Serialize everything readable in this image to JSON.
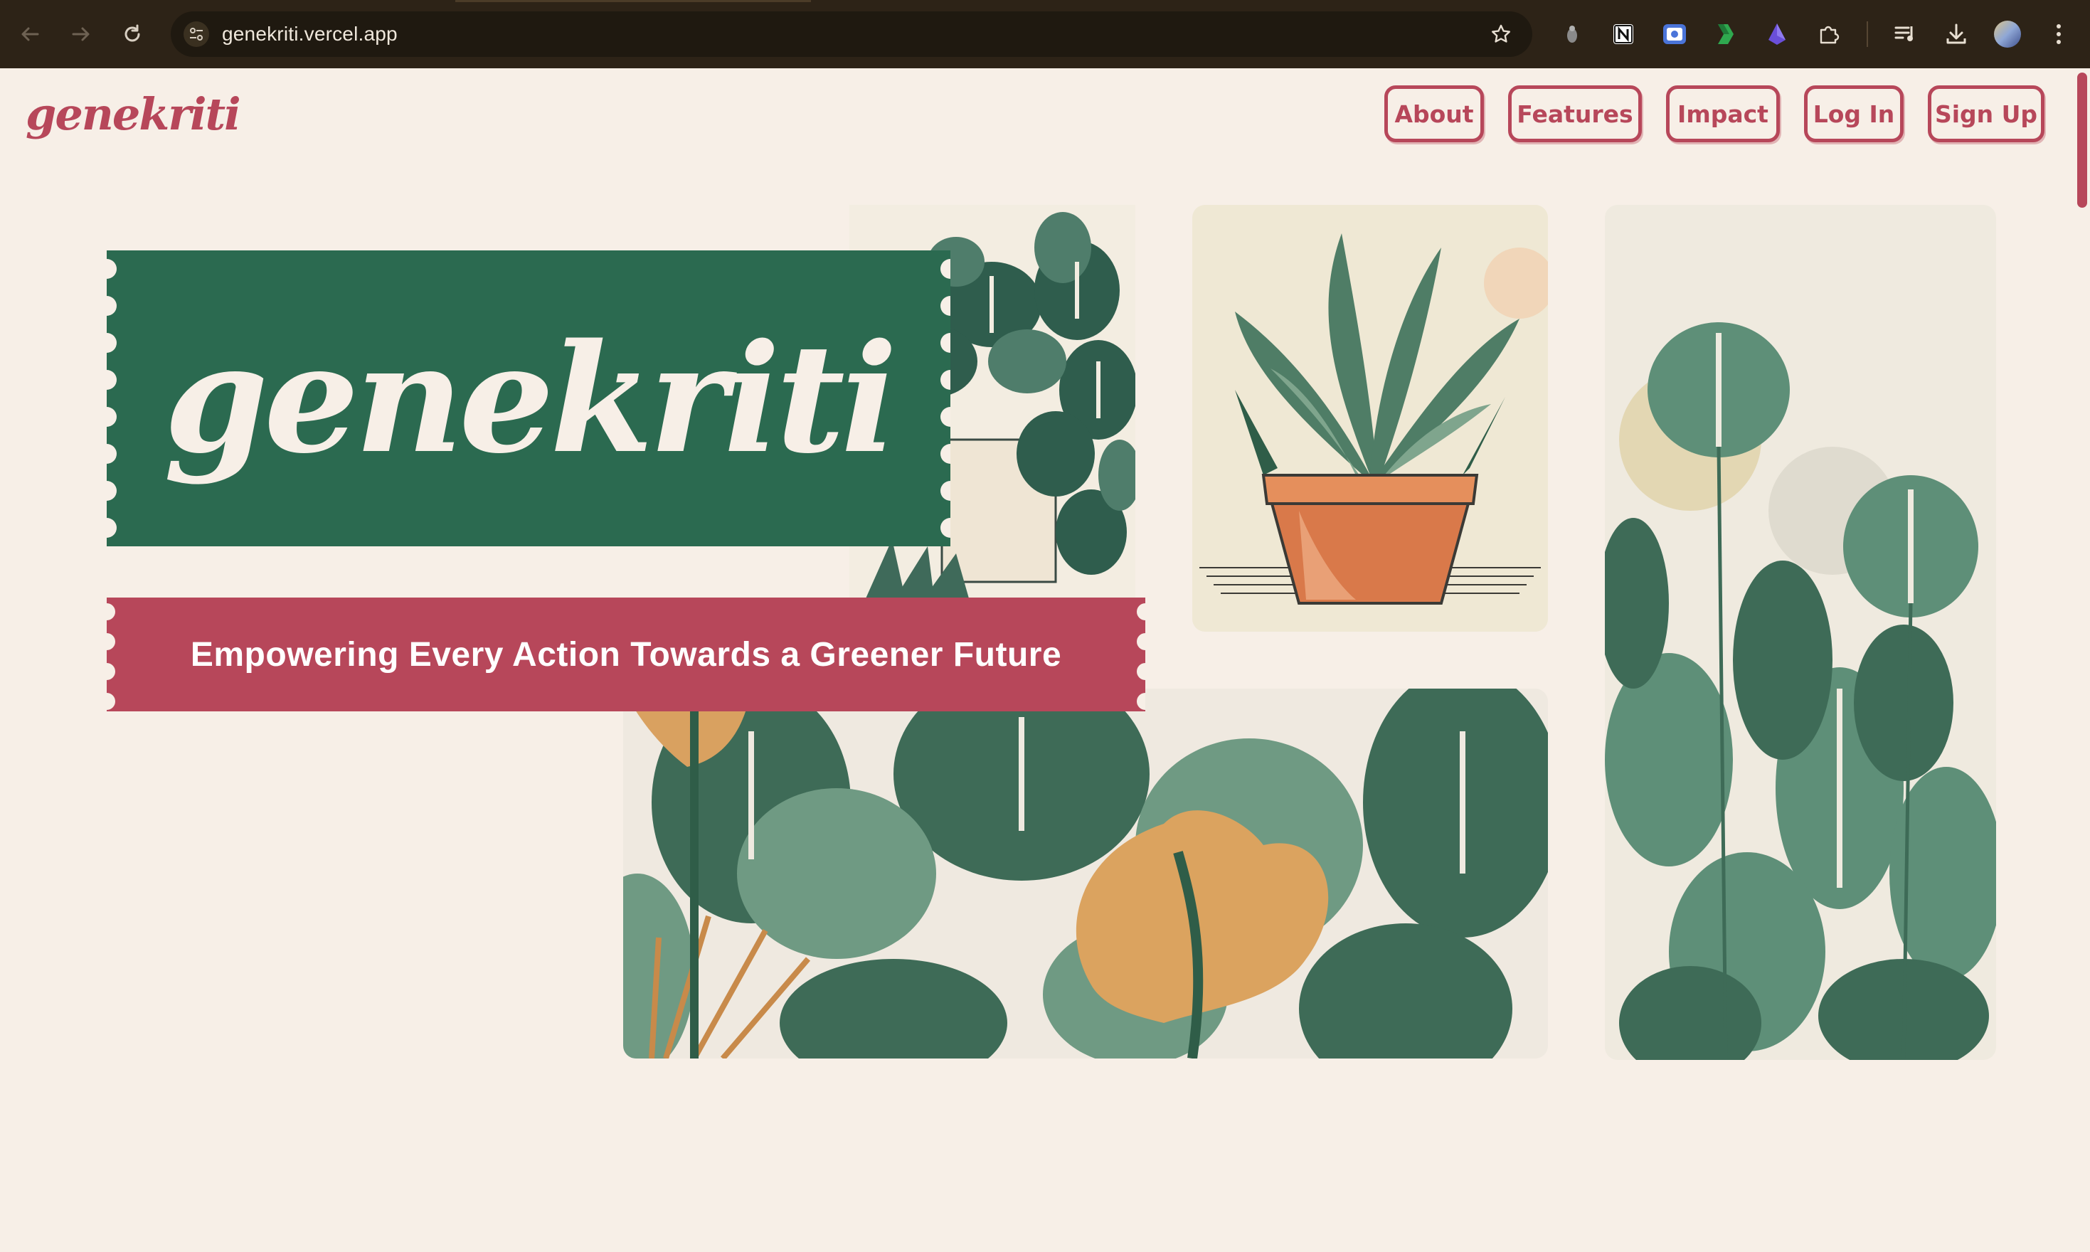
{
  "browser": {
    "url": "genekriti.vercel.app",
    "icons": [
      "back-arrow-icon",
      "forward-arrow-icon",
      "reload-icon",
      "site-info-icon",
      "bookmark-star-icon",
      "extension-gray-icon",
      "notion-icon",
      "screen-capture-icon",
      "green-leaf-extension-icon",
      "purple-extension-icon",
      "puzzle-extensions-icon",
      "media-queue-icon",
      "download-icon",
      "profile-avatar-icon",
      "more-menu-icon"
    ]
  },
  "header": {
    "logo_text": "genekriti",
    "nav": [
      {
        "label": "About"
      },
      {
        "label": "Features"
      },
      {
        "label": "Impact"
      },
      {
        "label": "Log In"
      },
      {
        "label": "Sign Up"
      }
    ]
  },
  "hero": {
    "title": "genekriti",
    "tagline": "Empowering Every Action Towards a Greener Future"
  },
  "colors": {
    "background": "#f7efe7",
    "brand_red": "#b7475a",
    "brand_green": "#2b6a50",
    "chrome_bg": "#2d2317"
  }
}
